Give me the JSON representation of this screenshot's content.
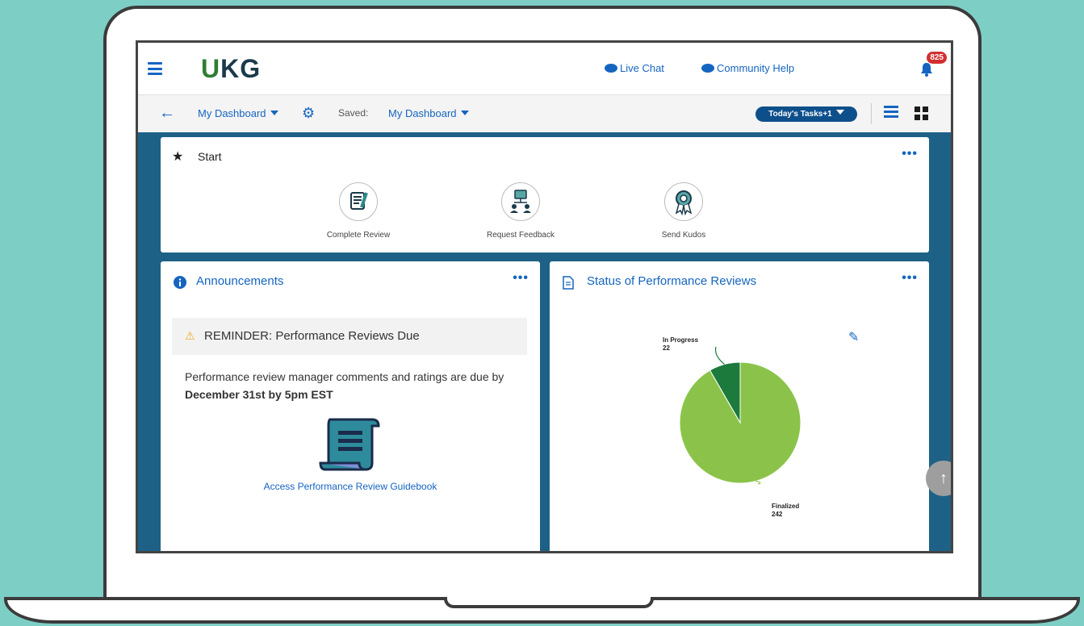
{
  "header": {
    "logo": "UKG",
    "live_chat": "Live Chat",
    "community_help": "Community Help",
    "notification_count": "825"
  },
  "subbar": {
    "dashboard_label": "My Dashboard",
    "saved_label": "Saved:",
    "saved_value": "My Dashboard",
    "tasks_label": "Today's Tasks+1"
  },
  "start_card": {
    "title": "Start",
    "items": [
      {
        "label": "Complete Review",
        "icon": "review-icon"
      },
      {
        "label": "Request Feedback",
        "icon": "feedback-icon"
      },
      {
        "label": "Send Kudos",
        "icon": "kudos-icon"
      }
    ]
  },
  "announcements": {
    "title": "Announcements",
    "reminder": "REMINDER: Performance Reviews Due",
    "body_prefix": "Performance review manager comments and ratings are due by ",
    "body_bold": "December 31st by 5pm EST",
    "link": "Access Performance Review Guidebook"
  },
  "status_card": {
    "title": "Status of Performance Reviews"
  },
  "chart_data": {
    "type": "pie",
    "labels": [
      "In Progress",
      "Finalized"
    ],
    "values": [
      22,
      242
    ],
    "colors": [
      "#1b7a3c",
      "#8bc34a"
    ]
  },
  "colors": {
    "accent": "#1565c0",
    "dashboard_bg": "#1e6187"
  }
}
